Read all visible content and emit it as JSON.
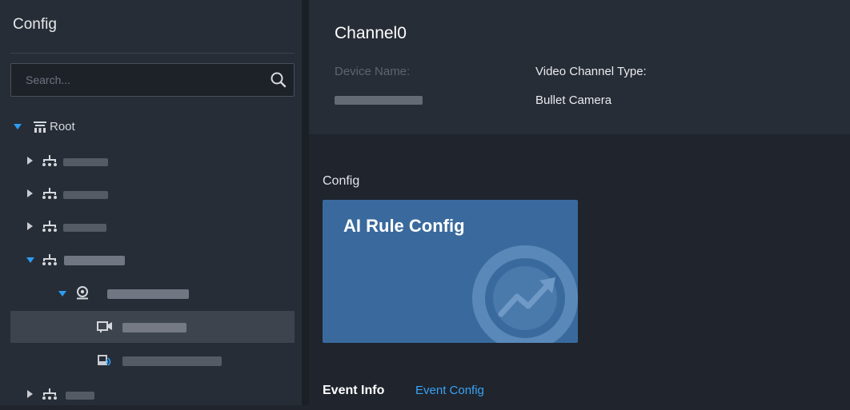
{
  "sidebar": {
    "title": "Config",
    "search": {
      "placeholder": "Search..."
    },
    "tree": {
      "root": {
        "label": "Root"
      }
    }
  },
  "channel": {
    "title": "Channel0",
    "device_name_label": "Device Name:",
    "video_channel_type_label": "Video Channel Type:",
    "video_channel_type_value": "Bullet Camera"
  },
  "config": {
    "section_title": "Config",
    "card_title": "AI Rule Config"
  },
  "event": {
    "title": "Event Info",
    "link": "Event Config"
  },
  "colors": {
    "accent": "#2b9cf2",
    "card": "#3a6a9d",
    "link": "#3aa3f5",
    "sidebar_bg": "#272d36",
    "main_bg": "#1f242d"
  }
}
